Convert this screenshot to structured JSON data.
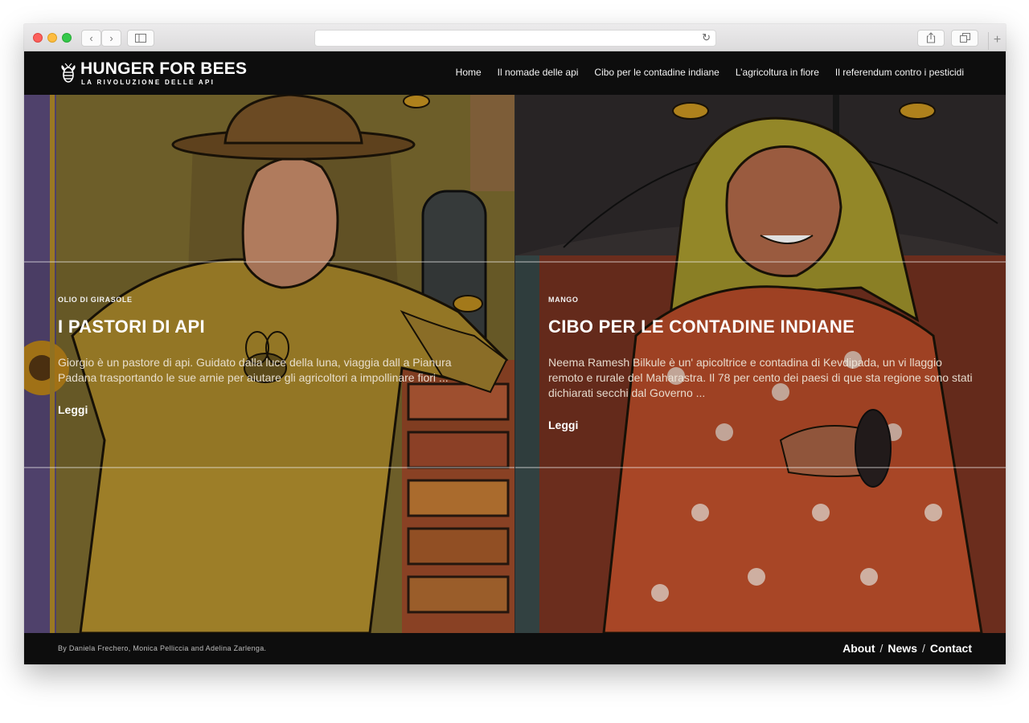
{
  "browser": {
    "url": "",
    "icons": {
      "back": "chevron-left-icon",
      "forward": "chevron-right-icon",
      "sidebar": "sidebar-icon",
      "reload": "reload-icon",
      "share": "share-icon",
      "tabs": "tabs-icon",
      "new_tab": "plus-icon"
    }
  },
  "header": {
    "logo_title": "HUNGER FOR BEES",
    "logo_subtitle": "LA RIVOLUZIONE DELLE API",
    "nav": [
      {
        "label": "Home"
      },
      {
        "label": "Il nomade delle api"
      },
      {
        "label": "Cibo per le contadine indiane"
      },
      {
        "label": "L’agricoltura in fiore"
      },
      {
        "label": "Il referendum contro i pesticidi"
      }
    ]
  },
  "stories": [
    {
      "category": "OLIO DI GIRASOLE",
      "title": "I PASTORI DI API",
      "excerpt": "Giorgio è un pastore di api. Guidato dalla luce della luna, viaggia dall a Pianura Padana trasportando le sue arnie per aiutare gli agricoltori a impollinare fiori ...",
      "read_more": "Leggi"
    },
    {
      "category": "MANGO",
      "title": "CIBO PER LE CONTADINE INDIANE",
      "excerpt": "Neema Ramesh Bilkule è un' apicoltrice e contadina di Kevdipada, un vi llaggio remoto e rurale del Maharastra. Il 78 per cento dei paesi di que sta regione sono stati dichiarati secchi dal Governo ...",
      "read_more": "Leggi"
    }
  ],
  "footer": {
    "credit": "By Daniela Frechero, Monica Pelliccia and Adelina Zarlenga.",
    "links": [
      {
        "label": "About"
      },
      {
        "label": "News"
      },
      {
        "label": "Contact"
      }
    ],
    "separator": "/"
  },
  "colors": {
    "header_bg": "#0d0d0d",
    "left_panel_tone": "#7b6a30",
    "right_panel_tone": "#5e2a1e"
  }
}
